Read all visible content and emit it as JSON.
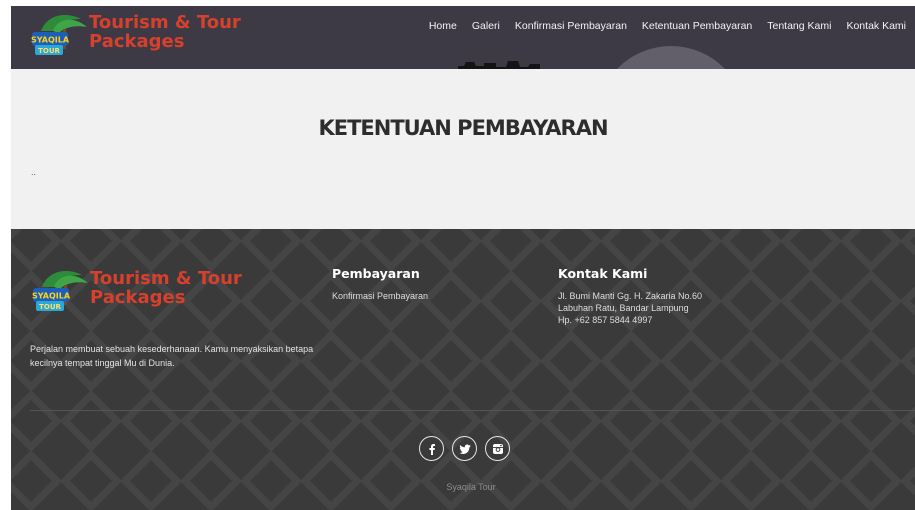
{
  "header": {
    "logo": {
      "badge_top": "SYAQILA",
      "badge_bottom": "TOUR",
      "line1": "Tourism & Tour",
      "line2": "Packages"
    },
    "nav": [
      {
        "label": "Home"
      },
      {
        "label": "Galeri"
      },
      {
        "label": "Konfirmasi Pembayaran"
      },
      {
        "label": "Ketentuan Pembayaran"
      },
      {
        "label": "Tentang Kami"
      },
      {
        "label": "Kontak Kami"
      }
    ]
  },
  "main": {
    "title": "KETENTUAN PEMBAYARAN",
    "content": ".."
  },
  "footer": {
    "logo": {
      "badge_top": "SYAQILA",
      "badge_bottom": "TOUR",
      "line1": "Tourism & Tour",
      "line2": "Packages"
    },
    "description": "Perjalan membuat sebuah kesederhanaan. Kamu menyaksikan betapa kecilnya tempat tinggal Mu di Dunia.",
    "pembayaran": {
      "title": "Pembayaran",
      "link": "Konfirmasi Pembayaran"
    },
    "kontak": {
      "title": "Kontak Kami",
      "lines": [
        "Jl. Bumi Manti Gg. H. Zakaria No.60",
        "Labuhan Ratu, Bandar Lampung",
        "Hp. +62 857 5844 4997"
      ]
    },
    "social": [
      "facebook-icon",
      "twitter-icon",
      "instagram-icon"
    ],
    "copyright": "Syaqila Tour"
  },
  "colors": {
    "brand": "#d6402c",
    "header_bg": "#3d3a45",
    "footer_bg": "#3a3a3a",
    "main_bg": "#f1f1f1"
  }
}
